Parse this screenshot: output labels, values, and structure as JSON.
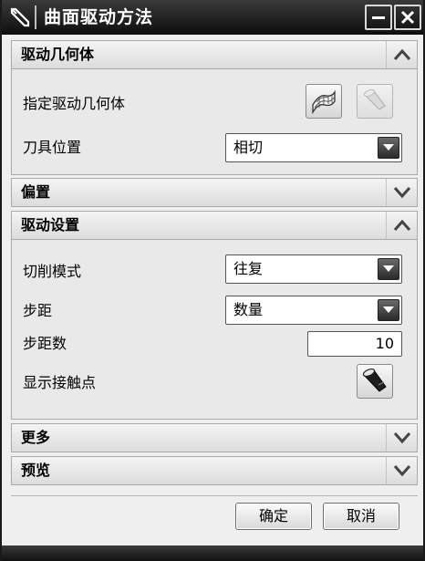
{
  "window": {
    "title": "曲面驱动方法"
  },
  "sections": {
    "drive_geometry": {
      "title": "驱动几何体",
      "expanded": true,
      "specify_label": "指定驱动几何体",
      "tool_position_label": "刀具位置",
      "tool_position_value": "相切"
    },
    "offset": {
      "title": "偏置",
      "expanded": false
    },
    "drive_settings": {
      "title": "驱动设置",
      "expanded": true,
      "cut_mode_label": "切削模式",
      "cut_mode_value": "往复",
      "stepover_label": "步距",
      "stepover_value": "数量",
      "stepover_count_label": "步距数",
      "stepover_count_value": "10",
      "show_contact_label": "显示接触点"
    },
    "more": {
      "title": "更多",
      "expanded": false
    },
    "preview": {
      "title": "预览",
      "expanded": false
    }
  },
  "buttons": {
    "ok": "确定",
    "cancel": "取消"
  },
  "icons": {
    "app": "pencil-icon",
    "specify_geometry": "surface-grid-icon",
    "flashlight": "flashlight-icon",
    "expand": "chevron-down-icon",
    "collapse": "chevron-up-icon"
  }
}
